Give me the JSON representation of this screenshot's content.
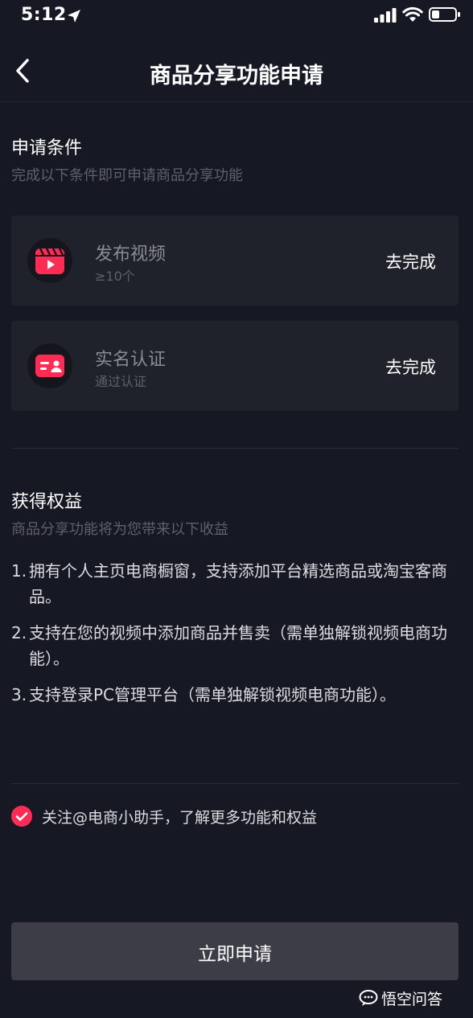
{
  "status_bar": {
    "time": "5:12"
  },
  "nav": {
    "title": "商品分享功能申请"
  },
  "conditions": {
    "title": "申请条件",
    "subtitle": "完成以下条件即可申请商品分享功能",
    "items": [
      {
        "title": "发布视频",
        "subtitle": "≥10个",
        "action": "去完成",
        "icon": "video-icon"
      },
      {
        "title": "实名认证",
        "subtitle": "通过认证",
        "action": "去完成",
        "icon": "id-card-icon"
      }
    ]
  },
  "benefits": {
    "title": "获得权益",
    "subtitle": "商品分享功能将为您带来以下收益",
    "items": [
      {
        "num": "1.",
        "text": "拥有个人主页电商橱窗，支持添加平台精选商品或淘宝客商品。"
      },
      {
        "num": "2.",
        "text": "支持在您的视频中添加商品并售卖（需单独解锁视频电商功能）。"
      },
      {
        "num": "3.",
        "text": "支持登录PC管理平台（需单独解锁视频电商功能）。"
      }
    ]
  },
  "follow": {
    "label": "关注@电商小助手，了解更多功能和权益",
    "checked": true
  },
  "apply_button": {
    "label": "立即申请"
  },
  "watermark": {
    "text": "悟空问答"
  },
  "colors": {
    "background": "#161823",
    "card": "#1f212b",
    "accent": "#fe2c55",
    "button": "#3c3d47"
  }
}
